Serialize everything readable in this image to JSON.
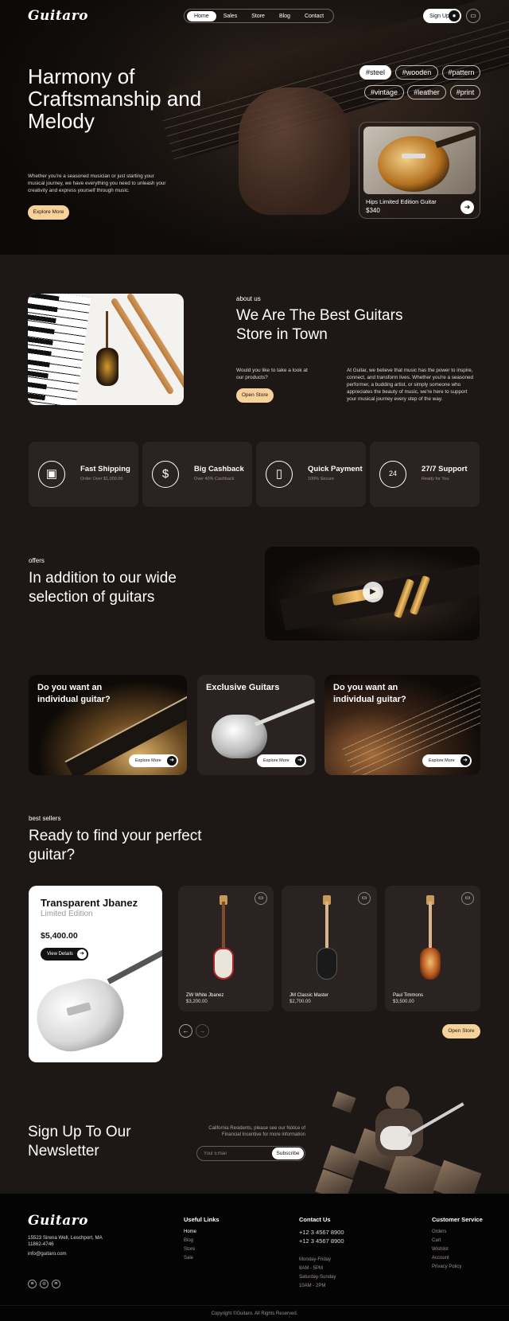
{
  "brand": "Guitaro",
  "nav": {
    "items": [
      "Home",
      "Sales",
      "Store",
      "Blog",
      "Contact"
    ],
    "active": "Home",
    "signup": "Sign Up"
  },
  "hero": {
    "title": "Harmony of Craftsmanship and Melody",
    "description": "Whether you're a seasoned musician or just starting your musical journey, we have everything you need to unleash your creativity and express yourself through music.",
    "cta": "Explore More",
    "tags": [
      "#steel",
      "#wooden",
      "#pattern",
      "#vintage",
      "#leather",
      "#print"
    ],
    "product": {
      "name": "Hips Limited Edition Guitar",
      "price": "$340"
    }
  },
  "about": {
    "label": "about us",
    "title": "We Are The Best Guitars Store in Town",
    "question": "Would you like to take a look at our products?",
    "paragraph": "At Guitar, we believe that music has the power to inspire, connect, and transform lives. Whether you're a seasoned performer, a budding artist, or simply someone who appreciates the beauty of music, we're here to support your musical journey every step of the way.",
    "cta": "Open Store"
  },
  "features": [
    {
      "title": "Fast Shipping",
      "sub": "Order Over $1,000.00",
      "icon": "box-icon"
    },
    {
      "title": "Big Cashback",
      "sub": "Over 40% Cashback",
      "icon": "cashback-icon"
    },
    {
      "title": "Quick Payment",
      "sub": "100% Secure",
      "icon": "phone-payment-icon"
    },
    {
      "title": "27/7 Support",
      "sub": "Ready for You",
      "icon": "support-icon"
    }
  ],
  "offers": {
    "label": "offers",
    "title": "In addition to our wide selection of guitars",
    "promos": [
      {
        "title": "Do you want an individual guitar?",
        "cta": "Explore More"
      },
      {
        "title": "Exclusive Guitars",
        "cta": "Explore More"
      },
      {
        "title": "Do you want an individual guitar?",
        "cta": "Explore More"
      }
    ]
  },
  "bestsellers": {
    "label": "best sellers",
    "title": "Ready to find your perfect guitar?",
    "featured": {
      "name": "Transparent Jbanez",
      "subtitle": "Limited Edition",
      "price": "$5,400.00",
      "cta": "View Details"
    },
    "products": [
      {
        "name": "ZW White Jbanez",
        "price": "$3,200.00",
        "color": "#e9e4dc"
      },
      {
        "name": "JM Classic Master",
        "price": "$2,700.00",
        "color": "#1a1a1a"
      },
      {
        "name": "Paul Timmons",
        "price": "$3,500.00",
        "color": "#b5561d"
      }
    ],
    "cta": "Open Store"
  },
  "newsletter": {
    "title": "Sign Up To Our Newsletter",
    "note": "California Residents, please see our Notice of Financial Incentive for more information",
    "placeholder": "Your Email",
    "button": "Subscribe"
  },
  "footer": {
    "address": "15523 Sirena Well, Leschport, MA 11862-4746",
    "email": "info@guitaro.com",
    "useful_links": {
      "title": "Useful Links",
      "items": [
        "Home",
        "Blog",
        "Store",
        "Sale"
      ]
    },
    "contact": {
      "title": "Contact Us",
      "phones": [
        "+12 3 4567 8900",
        "+12 3 4567 8900"
      ],
      "hours": [
        "Monday-Friday",
        "8AM - 5PM",
        "Saturday-Sunday",
        "10AM - 2PM"
      ]
    },
    "customer": {
      "title": "Customer Service",
      "items": [
        "Orders",
        "Cart",
        "Wishlist",
        "Account",
        "Privacy Policy"
      ]
    },
    "copyright": "Copyright ©Guitaro. All Rights Reserved."
  }
}
